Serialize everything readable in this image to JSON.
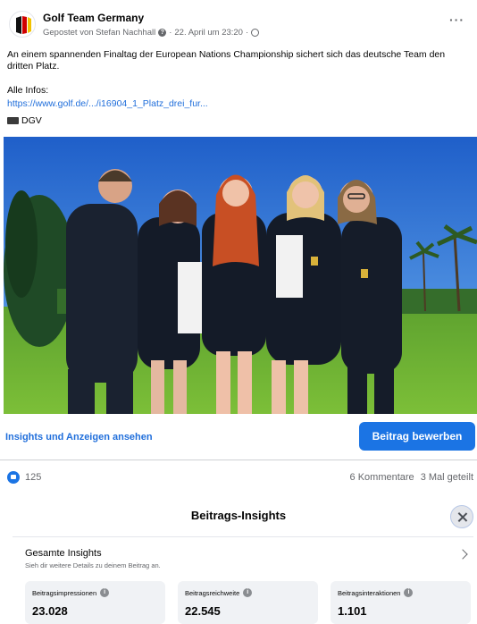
{
  "post": {
    "page_name": "Golf Team Germany",
    "author_line": "Gepostet von Stefan Nachhall",
    "timestamp": "22. April um 23:20",
    "text": "An einem spannenden Finaltag der European Nations Championship sichert sich das deutsche Team den dritten Platz.",
    "infos_label": "Alle Infos:",
    "link": "https://www.golf.de/.../i16904_1_Platz_drei_fur...",
    "source": "DGV",
    "more_icon": "more-horizontal-icon"
  },
  "actions": {
    "insights_link": "Insights und Anzeigen ansehen",
    "boost_button": "Beitrag bewerben"
  },
  "engagement": {
    "reactions": "125",
    "comments": "6 Kommentare",
    "shares": "3 Mal geteilt"
  },
  "insights": {
    "title": "Beitrags-Insights",
    "overview_title": "Gesamte Insights",
    "overview_sub": "Sieh dir weitere Details zu deinem Beitrag an.",
    "metrics": [
      {
        "label": "Beitragsimpressionen",
        "value": "23.028"
      },
      {
        "label": "Beitragsreichweite",
        "value": "22.545"
      },
      {
        "label": "Beitragsinteraktionen",
        "value": "1.101"
      }
    ]
  },
  "colors": {
    "accent": "#1b74e4",
    "link": "#216fdb",
    "secondary_text": "#65676b",
    "card_bg": "#f0f2f5"
  }
}
